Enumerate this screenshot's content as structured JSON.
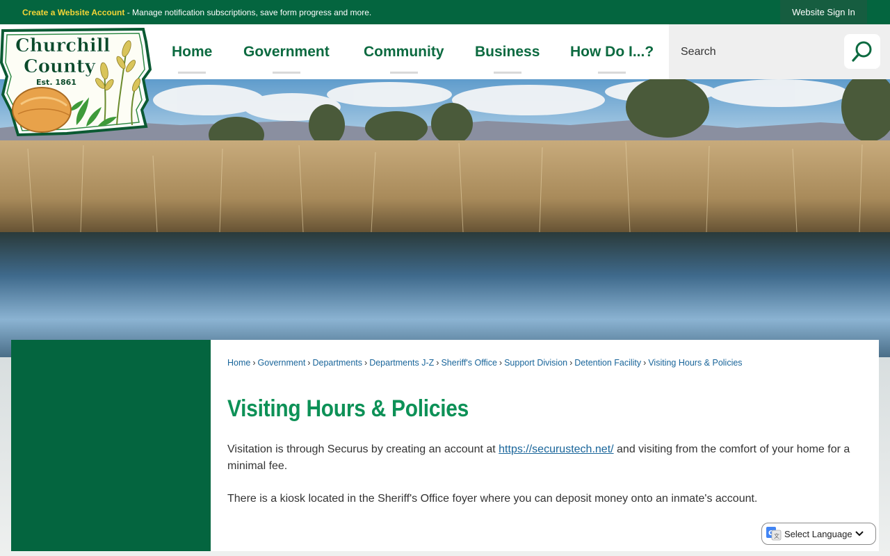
{
  "topbar": {
    "create_account_link": "Create a Website Account",
    "account_message": " - Manage notification subscriptions, save form progress and more.",
    "sign_in_label": "Website Sign In"
  },
  "logo": {
    "line1": "Churchill",
    "line2": "County",
    "est": "Est. 1861"
  },
  "nav": {
    "items": [
      {
        "label": "Home"
      },
      {
        "label": "Government"
      },
      {
        "label": "Community"
      },
      {
        "label": "Business"
      },
      {
        "label": "How Do I...?"
      }
    ]
  },
  "search": {
    "placeholder": "Search"
  },
  "breadcrumb": {
    "items": [
      "Home",
      "Government",
      "Departments",
      "Departments J-Z",
      "Sheriff's Office",
      "Support Division",
      "Detention Facility",
      "Visiting Hours & Policies"
    ],
    "separator": "›"
  },
  "page": {
    "title": "Visiting Hours & Policies",
    "para1_before": "Visitation is through Securus by creating an account at ",
    "para1_link": "https://securustech.net/",
    "para1_after": " and visiting from the comfort of your home for a minimal fee.",
    "para2": "There is a kiosk located in the Sheriff's Office foyer where you can deposit money onto an inmate's account."
  },
  "translate": {
    "label": "Select Language"
  },
  "colors": {
    "brand_green": "#04653f",
    "title_green": "#0d9157",
    "create_account_yellow": "#f3d437",
    "link_blue": "#19659a"
  },
  "icons": {
    "search": "search-icon",
    "google_translate": "google-translate-icon",
    "chevron": "chevron-down-icon"
  }
}
